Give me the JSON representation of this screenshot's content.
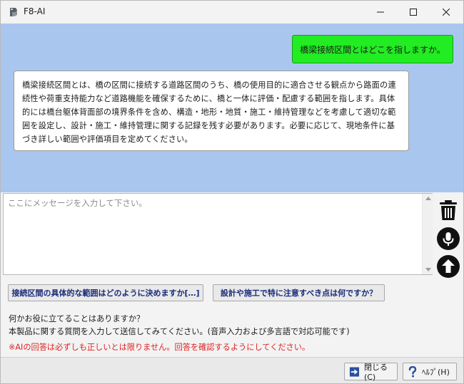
{
  "window": {
    "title": "F8-AI"
  },
  "chat": {
    "user_message": "橋梁接続区間とはどこを指しますか。",
    "ai_message": "橋梁接続区間とは、橋の区間に接続する道路区間のうち、橋の使用目的に適合させる観点から路面の連続性や荷重支持能力など道路機能を確保するために、橋と一体に評価・配慮する範囲を指します。具体的には橋台躯体背面部の境界条件を含め、構造・地形・地質・施工・維持管理などを考慮して適切な範囲を設定し、設計・施工・維持管理に関する記録を残す必要があります。必要に応じて、現地条件に基づき詳しい範囲や評価項目を定めてください。"
  },
  "input": {
    "placeholder": "ここにメッセージを入力して下さい。",
    "value": ""
  },
  "suggestions": [
    {
      "label": "接続区間の具体的な範囲はどのように決めますか[…]"
    },
    {
      "label": "設計や施工で特に注意すべき点は何ですか？"
    }
  ],
  "help": {
    "line1": "何かお役に立てることはありますか？",
    "line2": "本製品に関する質問を入力して送信してみてください。(音声入力および多言語で対応可能です)",
    "warning": "※AIの回答は必ずしも正しいとは限りません。回答を確認するようにしてください。"
  },
  "footer": {
    "close_label": "閉じる(C)",
    "help_label": "ﾍﾙﾌﾟ(H)"
  },
  "colors": {
    "chat_background": "#a9c7ee",
    "user_bubble": "#22ec22",
    "warning_text": "#e02020",
    "suggestion_text": "#1a2a7a"
  }
}
